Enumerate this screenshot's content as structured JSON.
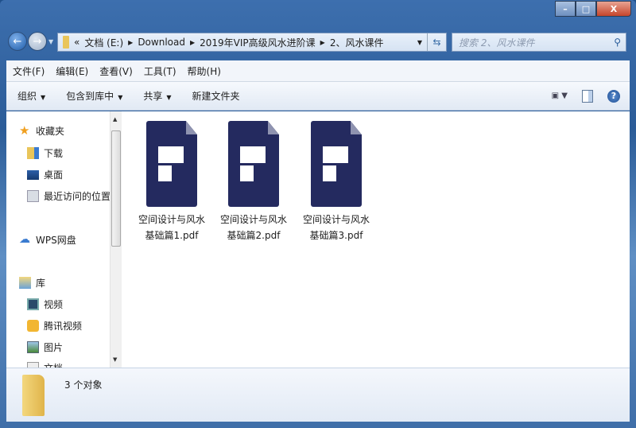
{
  "window": {
    "controls": {
      "minimize": "–",
      "maximize": "□",
      "close": "X"
    }
  },
  "address": {
    "prefix": "«",
    "crumbs": [
      "文档 (E:)",
      "Download",
      "2019年VIP高级风水进阶课",
      "2、风水课件"
    ]
  },
  "search": {
    "placeholder": "搜索 2、风水课件"
  },
  "menu": [
    "文件(F)",
    "编辑(E)",
    "查看(V)",
    "工具(T)",
    "帮助(H)"
  ],
  "toolbar": {
    "organize": "组织",
    "include_library": "包含到库中",
    "share": "共享",
    "new_folder": "新建文件夹",
    "help": "?"
  },
  "sidebar": {
    "favorites": "收藏夹",
    "downloads": "下载",
    "desktop": "桌面",
    "recent": "最近访问的位置",
    "wps": "WPS网盘",
    "libraries": "库",
    "videos": "视频",
    "tencent_video": "腾讯视频",
    "pictures": "图片",
    "documents": "文档"
  },
  "files": [
    {
      "line1": "空间设计与风水",
      "line2": "基础篇1.pdf"
    },
    {
      "line1": "空间设计与风水",
      "line2": "基础篇2.pdf"
    },
    {
      "line1": "空间设计与风水",
      "line2": "基础篇3.pdf"
    }
  ],
  "status": {
    "count": "3 个对象"
  },
  "colors": {
    "pdf_icon": "#242a5f",
    "frame": "#2f5f99"
  }
}
